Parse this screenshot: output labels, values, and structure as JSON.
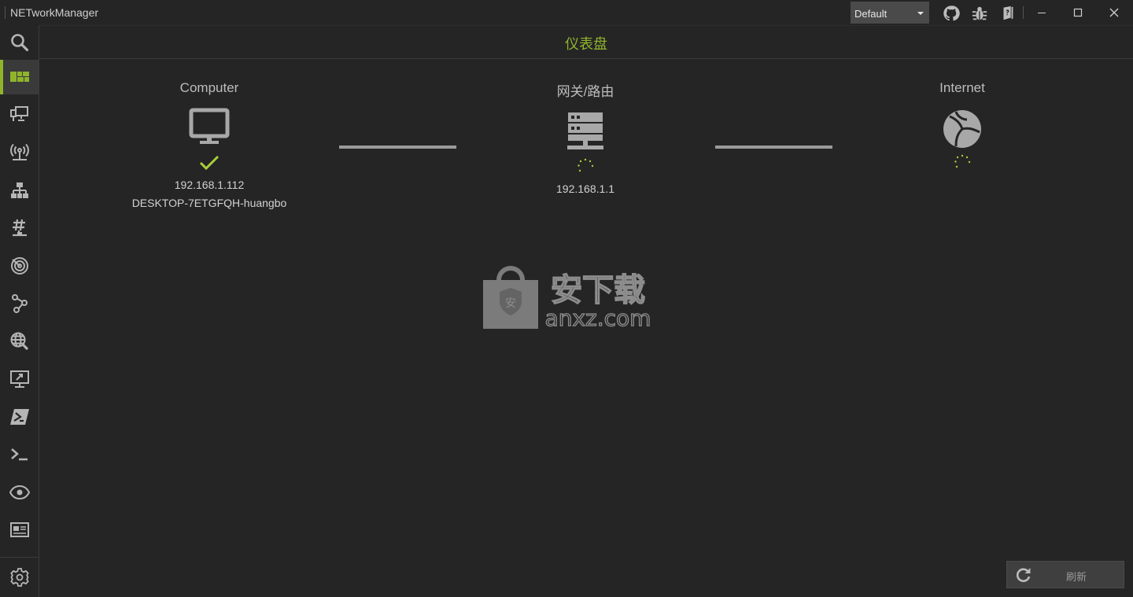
{
  "app": {
    "title": "NETworkManager",
    "profile": "Default"
  },
  "titlebar": {
    "icons": [
      "github-icon",
      "bug-icon",
      "book-icon"
    ],
    "window_controls": [
      "minimize-icon",
      "maximize-icon",
      "close-icon"
    ]
  },
  "sidebar": {
    "items": [
      {
        "name": "search-icon"
      },
      {
        "name": "dashboard-icon",
        "active": true
      },
      {
        "name": "network-interface-icon"
      },
      {
        "name": "wifi-icon"
      },
      {
        "name": "ip-scanner-icon"
      },
      {
        "name": "port-scanner-icon"
      },
      {
        "name": "ping-icon"
      },
      {
        "name": "traceroute-icon"
      },
      {
        "name": "dns-lookup-icon"
      },
      {
        "name": "remote-desktop-icon"
      },
      {
        "name": "powershell-icon"
      },
      {
        "name": "terminal-icon"
      },
      {
        "name": "eye-icon"
      },
      {
        "name": "whois-icon"
      }
    ],
    "settings": "gear-icon"
  },
  "page": {
    "title": "仪表盘"
  },
  "nodes": {
    "computer": {
      "label": "Computer",
      "ip": "192.168.1.112",
      "hostname": "DESKTOP-7ETGFQH-huangbo",
      "status": "ok"
    },
    "gateway": {
      "label": "网关/路由",
      "ip": "192.168.1.1",
      "status": "loading"
    },
    "internet": {
      "label": "Internet",
      "status": "loading"
    }
  },
  "watermark": {
    "cn": "安下载",
    "en": "anxz.com",
    "badge": "安"
  },
  "footer": {
    "refresh_label": "刷新"
  },
  "colors": {
    "accent": "#8fb42c",
    "background": "#252525",
    "icon": "#a8a8a8"
  }
}
